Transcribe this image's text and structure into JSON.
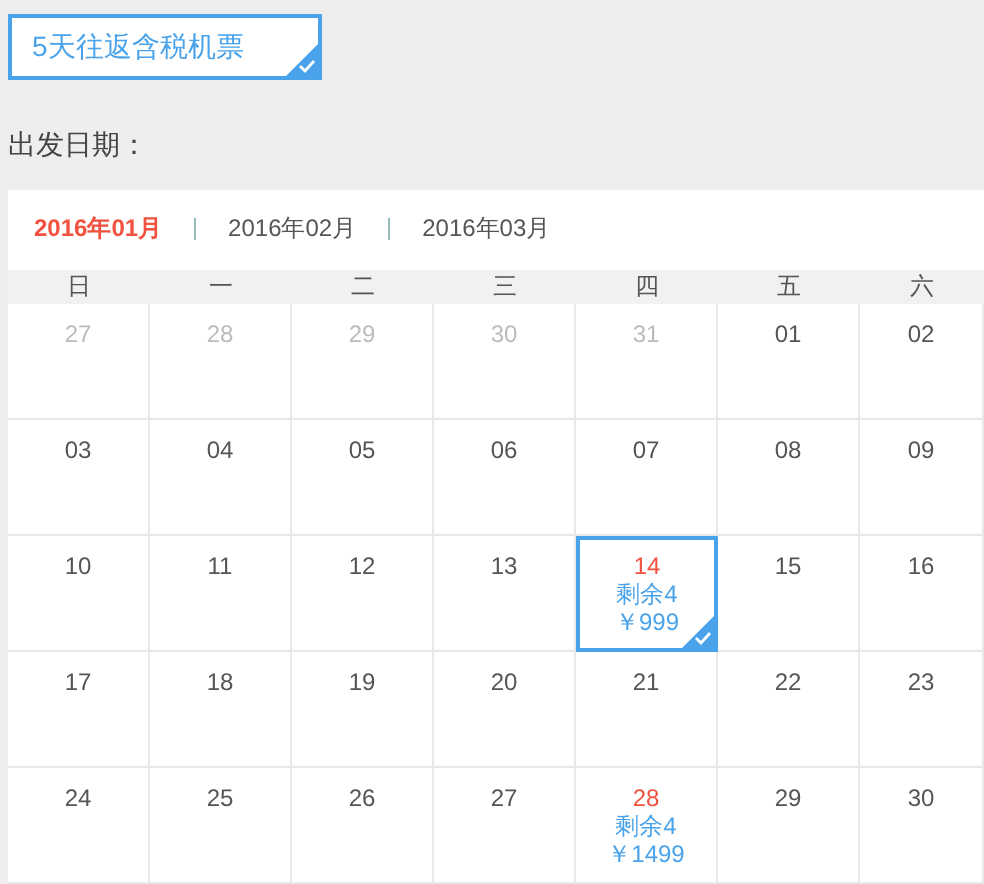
{
  "ticket_option": {
    "label": "5天往返含税机票",
    "selected": true
  },
  "departure_label": "出发日期：",
  "months": [
    {
      "label": "2016年01月",
      "selected": true
    },
    {
      "label": "2016年02月",
      "selected": false
    },
    {
      "label": "2016年03月",
      "selected": false
    }
  ],
  "weekdays": [
    "日",
    "一",
    "二",
    "三",
    "四",
    "五",
    "六"
  ],
  "days": [
    {
      "day": "27",
      "outside": true,
      "selected": false
    },
    {
      "day": "28",
      "outside": true,
      "selected": false
    },
    {
      "day": "29",
      "outside": true,
      "selected": false
    },
    {
      "day": "30",
      "outside": true,
      "selected": false
    },
    {
      "day": "31",
      "outside": true,
      "selected": false
    },
    {
      "day": "01",
      "outside": false,
      "selected": false
    },
    {
      "day": "02",
      "outside": false,
      "selected": false
    },
    {
      "day": "03",
      "outside": false,
      "selected": false
    },
    {
      "day": "04",
      "outside": false,
      "selected": false
    },
    {
      "day": "05",
      "outside": false,
      "selected": false
    },
    {
      "day": "06",
      "outside": false,
      "selected": false
    },
    {
      "day": "07",
      "outside": false,
      "selected": false
    },
    {
      "day": "08",
      "outside": false,
      "selected": false
    },
    {
      "day": "09",
      "outside": false,
      "selected": false
    },
    {
      "day": "10",
      "outside": false,
      "selected": false
    },
    {
      "day": "11",
      "outside": false,
      "selected": false
    },
    {
      "day": "12",
      "outside": false,
      "selected": false
    },
    {
      "day": "13",
      "outside": false,
      "selected": false
    },
    {
      "day": "14",
      "outside": false,
      "selected": true,
      "remaining": "剩余4",
      "price": "￥999"
    },
    {
      "day": "15",
      "outside": false,
      "selected": false
    },
    {
      "day": "16",
      "outside": false,
      "selected": false
    },
    {
      "day": "17",
      "outside": false,
      "selected": false
    },
    {
      "day": "18",
      "outside": false,
      "selected": false
    },
    {
      "day": "19",
      "outside": false,
      "selected": false
    },
    {
      "day": "20",
      "outside": false,
      "selected": false
    },
    {
      "day": "21",
      "outside": false,
      "selected": false
    },
    {
      "day": "22",
      "outside": false,
      "selected": false
    },
    {
      "day": "23",
      "outside": false,
      "selected": false
    },
    {
      "day": "24",
      "outside": false,
      "selected": false
    },
    {
      "day": "25",
      "outside": false,
      "selected": false
    },
    {
      "day": "26",
      "outside": false,
      "selected": false
    },
    {
      "day": "27",
      "outside": false,
      "selected": false
    },
    {
      "day": "28",
      "outside": false,
      "selected": false,
      "remaining": "剩余4",
      "price": "￥1499"
    },
    {
      "day": "29",
      "outside": false,
      "selected": false
    },
    {
      "day": "30",
      "outside": false,
      "selected": false
    }
  ]
}
